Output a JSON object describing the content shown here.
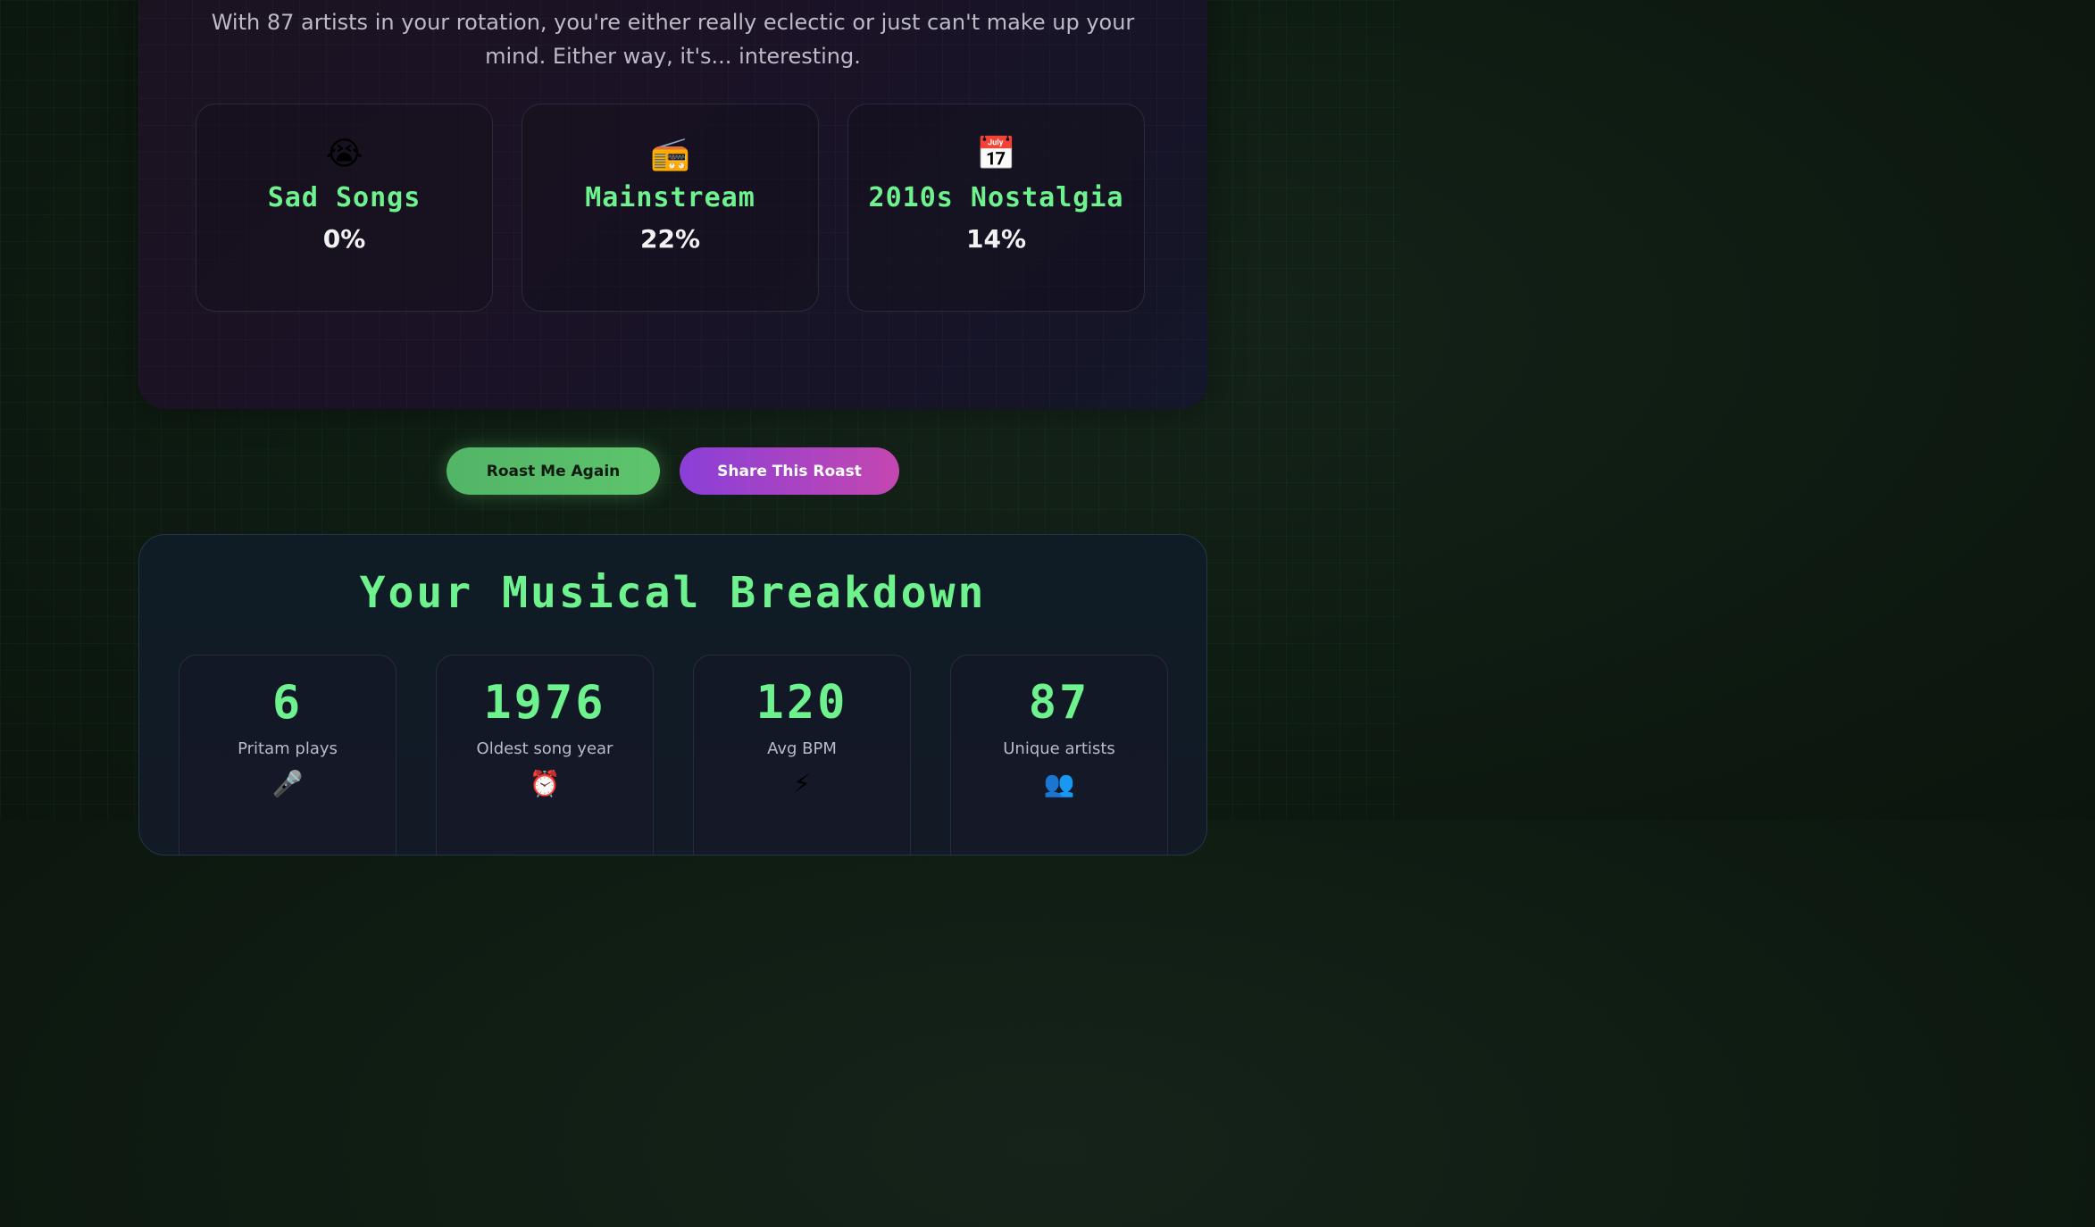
{
  "roast": {
    "text": "With 87 artists in your rotation, you're either really eclectic or just can't make up your mind. Either way, it's... interesting.",
    "traits": [
      {
        "emoji": "😭",
        "icon": "crying-face-icon",
        "title": "Sad Songs",
        "value": "0%"
      },
      {
        "emoji": "📻",
        "icon": "radio-icon",
        "title": "Mainstream",
        "value": "22%"
      },
      {
        "emoji": "📅",
        "icon": "calendar-icon",
        "title": "2010s Nostalgia",
        "value": "14%"
      }
    ]
  },
  "buttons": {
    "roast_again": "Roast Me Again",
    "share": "Share This Roast"
  },
  "breakdown": {
    "title": "Your Musical Breakdown",
    "stats": [
      {
        "value": "6",
        "label": "Pritam plays",
        "emoji": "🎤",
        "icon": "microphone-icon"
      },
      {
        "value": "1976",
        "label": "Oldest song year",
        "emoji": "⏰",
        "icon": "alarm-clock-icon"
      },
      {
        "value": "120",
        "label": "Avg BPM",
        "emoji": "⚡",
        "icon": "lightning-icon"
      },
      {
        "value": "87",
        "label": "Unique artists",
        "emoji": "👥",
        "icon": "people-icon"
      }
    ]
  },
  "colors": {
    "accent_green": "#6ef28e",
    "button_green": "#5ec46c",
    "button_purple": "#8a3fd8",
    "button_pink": "#c447b0"
  }
}
